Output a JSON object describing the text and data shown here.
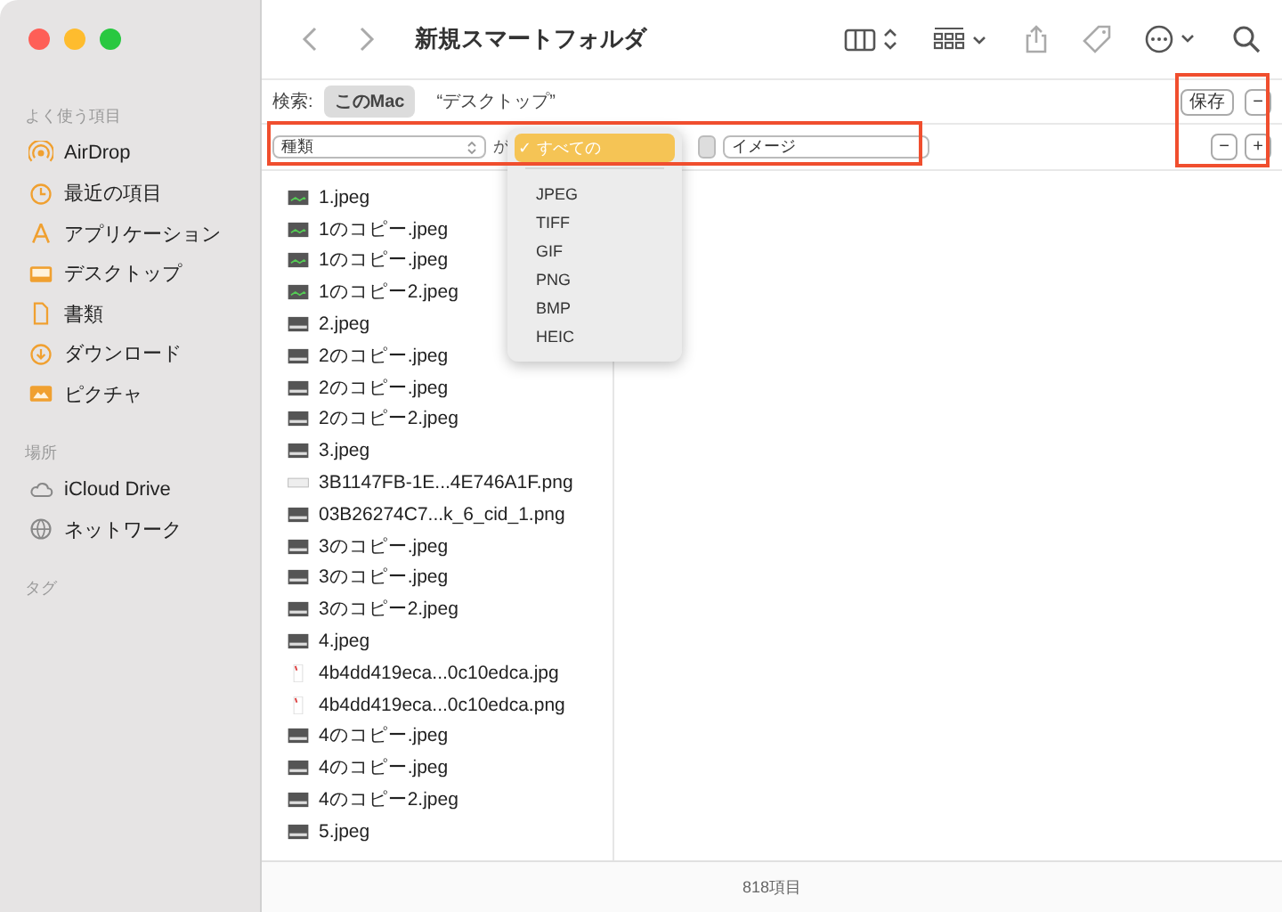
{
  "window": {
    "title": "新規スマートフォルダ"
  },
  "sidebar": {
    "sections": [
      {
        "heading": "よく使う項目",
        "items": [
          {
            "label": "AirDrop",
            "kind": "airdrop"
          },
          {
            "label": "最近の項目",
            "kind": "clock"
          },
          {
            "label": "アプリケーション",
            "kind": "apps"
          },
          {
            "label": "デスクトップ",
            "kind": "desktop"
          },
          {
            "label": "書類",
            "kind": "doc"
          },
          {
            "label": "ダウンロード",
            "kind": "download"
          },
          {
            "label": "ピクチャ",
            "kind": "picture"
          }
        ]
      },
      {
        "heading": "場所",
        "items": [
          {
            "label": "iCloud Drive",
            "kind": "cloud"
          },
          {
            "label": "ネットワーク",
            "kind": "globe"
          }
        ]
      },
      {
        "heading": "タグ"
      }
    ]
  },
  "search": {
    "label": "検索:",
    "scopes": [
      {
        "label": "このMac",
        "selected": true
      },
      {
        "label": "“デスクトップ”",
        "selected": false
      }
    ],
    "save": "保存",
    "minus": "−"
  },
  "criteria": {
    "attribute": "種類",
    "connector": "が",
    "value": "イメージ",
    "minus": "−",
    "plus": "+"
  },
  "menu": {
    "items": [
      {
        "label": "すべての",
        "selected": true,
        "mark": "✓"
      },
      {
        "label": "JPEG",
        "selected": false
      },
      {
        "label": "TIFF",
        "selected": false
      },
      {
        "label": "GIF",
        "selected": false
      },
      {
        "label": "PNG",
        "selected": false
      },
      {
        "label": "BMP",
        "selected": false
      },
      {
        "label": "HEIC",
        "selected": false
      }
    ]
  },
  "files": [
    {
      "name": "1.jpeg",
      "kind": "green"
    },
    {
      "name": "1のコピー.jpeg",
      "kind": "green"
    },
    {
      "name": "1のコピー.jpeg",
      "kind": "green"
    },
    {
      "name": "1のコピー2.jpeg",
      "kind": "green"
    },
    {
      "name": "2.jpeg",
      "kind": "dark"
    },
    {
      "name": "2のコピー.jpeg",
      "kind": "dark"
    },
    {
      "name": "2のコピー.jpeg",
      "kind": "dark"
    },
    {
      "name": "2のコピー2.jpeg",
      "kind": "dark"
    },
    {
      "name": "3.jpeg",
      "kind": "dark"
    },
    {
      "name": "3B1147FB-1E...4E746A1F.png",
      "kind": "light"
    },
    {
      "name": "03B26274C7...k_6_cid_1.png",
      "kind": "dark"
    },
    {
      "name": "3のコピー.jpeg",
      "kind": "dark"
    },
    {
      "name": "3のコピー.jpeg",
      "kind": "dark"
    },
    {
      "name": "3のコピー2.jpeg",
      "kind": "dark"
    },
    {
      "name": "4.jpeg",
      "kind": "dark"
    },
    {
      "name": "4b4dd419eca...0c10edca.jpg",
      "kind": "doc"
    },
    {
      "name": "4b4dd419eca...0c10edca.png",
      "kind": "doc"
    },
    {
      "name": "4のコピー.jpeg",
      "kind": "dark"
    },
    {
      "name": "4のコピー.jpeg",
      "kind": "dark"
    },
    {
      "name": "4のコピー2.jpeg",
      "kind": "dark"
    },
    {
      "name": "5.jpeg",
      "kind": "dark"
    }
  ],
  "status_bar": {
    "count": "818項目"
  }
}
